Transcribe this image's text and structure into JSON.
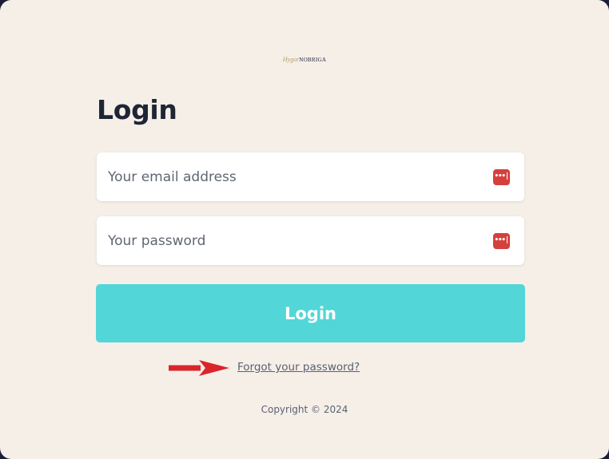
{
  "logo": {
    "script_text": "Hygor",
    "brand_text": "NOBRIGA"
  },
  "title": "Login",
  "email": {
    "placeholder": "Your email address",
    "value": ""
  },
  "password": {
    "placeholder": "Your password",
    "value": ""
  },
  "password_manager_icon": {
    "icon": "password-manager-icon",
    "glyph": "•••|",
    "color": "#d6403c"
  },
  "login_button": {
    "label": "Login",
    "color": "#53d6d8"
  },
  "forgot_link": "Forgot your password?",
  "annotation_arrow": {
    "icon": "arrow-right-icon",
    "color": "#d9262b"
  },
  "copyright": "Copyright © 2024",
  "colors": {
    "background": "#f5efe8",
    "text": "#1e2535",
    "muted": "#5a6070"
  }
}
